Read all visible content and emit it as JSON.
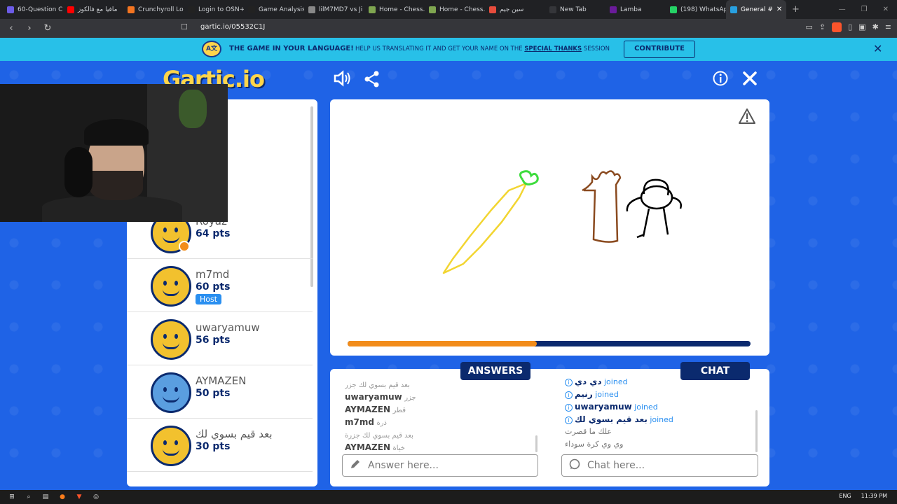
{
  "browser": {
    "tabs": [
      {
        "label": "60-Question C",
        "color": "#6c5ce7"
      },
      {
        "label": "مافيا مع فالكوز",
        "color": "#ff0000"
      },
      {
        "label": "Crunchyroll Lo",
        "color": "#f47521"
      },
      {
        "label": "Login to OSN+",
        "color": "#222222"
      },
      {
        "label": "Game Analysis",
        "color": "#222222"
      },
      {
        "label": "lilM7MD7 vs Ji",
        "color": "#888888"
      },
      {
        "label": "Home - Chess.",
        "color": "#7fa650"
      },
      {
        "label": "Home - Chess.",
        "color": "#7fa650"
      },
      {
        "label": "سين جيم",
        "color": "#e74c3c"
      },
      {
        "label": "New Tab",
        "color": "#35363a"
      },
      {
        "label": "Lamba",
        "color": "#6a1b9a"
      },
      {
        "label": "(198) WhatsAp",
        "color": "#25d366"
      },
      {
        "label": "General #",
        "color": "#28a0e0"
      }
    ],
    "url": "gartic.io/05532C1J"
  },
  "banner": {
    "icon_text": "A文",
    "title": "THE GAME IN YOUR LANGUAGE!",
    "text_pre": "HELP US TRANSLATING IT AND GET YOUR NAME ON THE ",
    "text_link": "SPECIAL THANKS",
    "text_post": " SESSION",
    "button": "CONTRIBUTE",
    "close": "✕"
  },
  "logo": {
    "main": "Gartic",
    "suffix": ".io"
  },
  "players": [
    {
      "name": "Royaz",
      "points": "64 pts",
      "host": false,
      "dot": true,
      "avatar": "yellow"
    },
    {
      "name": "m7md",
      "points": "60 pts",
      "host": true,
      "dot": false,
      "avatar": "yellow"
    },
    {
      "name": "uwaryamuw",
      "points": "56 pts",
      "host": false,
      "dot": false,
      "avatar": "yellow"
    },
    {
      "name": "AYMAZEN",
      "points": "50 pts",
      "host": false,
      "dot": false,
      "avatar": "blue"
    },
    {
      "name": "بعد قيم بسوي لك",
      "points": "30 pts",
      "host": false,
      "dot": false,
      "avatar": "yellow"
    }
  ],
  "host_label": "Host",
  "timer_progress": 0.47,
  "tabs": {
    "answers": "ANSWERS",
    "chat": "CHAT"
  },
  "answers": [
    {
      "user": "",
      "text": "بعد قيم بسوي لك جزر"
    },
    {
      "user": "uwaryamuw",
      "text": "جزر"
    },
    {
      "user": "AYMAZEN",
      "text": "قطر"
    },
    {
      "user": "m7md",
      "text": "ذرة"
    },
    {
      "user": "",
      "text": "بعد قيم بسوي لك جزرة"
    },
    {
      "user": "AYMAZEN",
      "text": "خياة"
    }
  ],
  "chat": [
    {
      "type": "info",
      "user": "دي دي",
      "text": "joined"
    },
    {
      "type": "info",
      "user": "رنيم",
      "text": "joined"
    },
    {
      "type": "info",
      "user": "uwaryamuw",
      "text": "joined"
    },
    {
      "type": "info",
      "user": "بعد قيم بسوي لك",
      "text": "joined"
    },
    {
      "type": "plain",
      "user": "",
      "text": "علك ما قصرت"
    },
    {
      "type": "plain",
      "user": "",
      "text": "وي وي كرة سوداء"
    }
  ],
  "answer_placeholder": "Answer here...",
  "chat_placeholder": "Chat here...",
  "taskbar": {
    "lang": "ENG",
    "time": "11:39 PM"
  }
}
